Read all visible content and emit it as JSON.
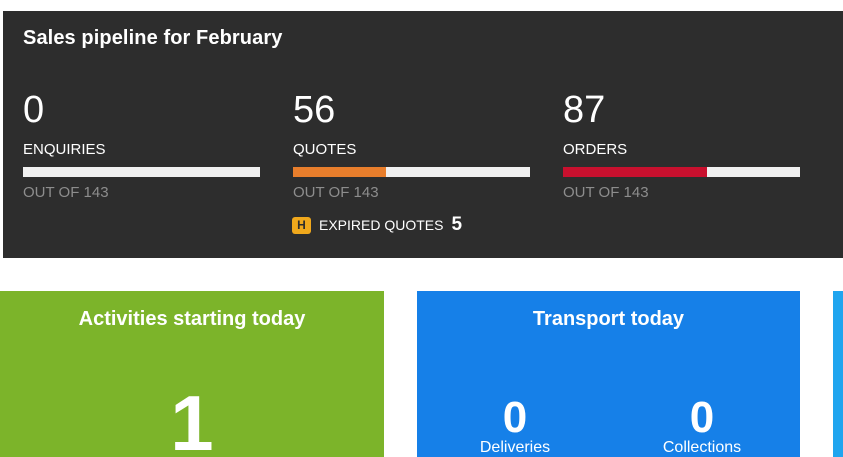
{
  "pipeline": {
    "title": "Sales pipeline for February",
    "metrics": [
      {
        "count": "0",
        "label": "ENQUIRIES",
        "out_of": "OUT OF 143",
        "fraction": 0.0,
        "color": "#e87e2c"
      },
      {
        "count": "56",
        "label": "QUOTES",
        "out_of": "OUT OF 143",
        "fraction": 0.3916,
        "color": "#e87e2c"
      },
      {
        "count": "87",
        "label": "ORDERS",
        "out_of": "OUT OF 143",
        "fraction": 0.6084,
        "color": "#c8102e"
      }
    ],
    "expired": {
      "badge": "H",
      "label": "EXPIRED QUOTES",
      "count": "5"
    }
  },
  "tiles": {
    "activities": {
      "title": "Activities starting today",
      "count": "1"
    },
    "transport": {
      "title": "Transport today",
      "deliveries": {
        "count": "0",
        "label": "Deliveries"
      },
      "collections": {
        "count": "0",
        "label": "Collections"
      }
    }
  },
  "colors": {
    "pipeline_bg": "#2d2d2d",
    "activities_bg": "#7cb42a",
    "transport_bg": "#1680e8",
    "edge_tile_bg": "#1fa5ef"
  }
}
